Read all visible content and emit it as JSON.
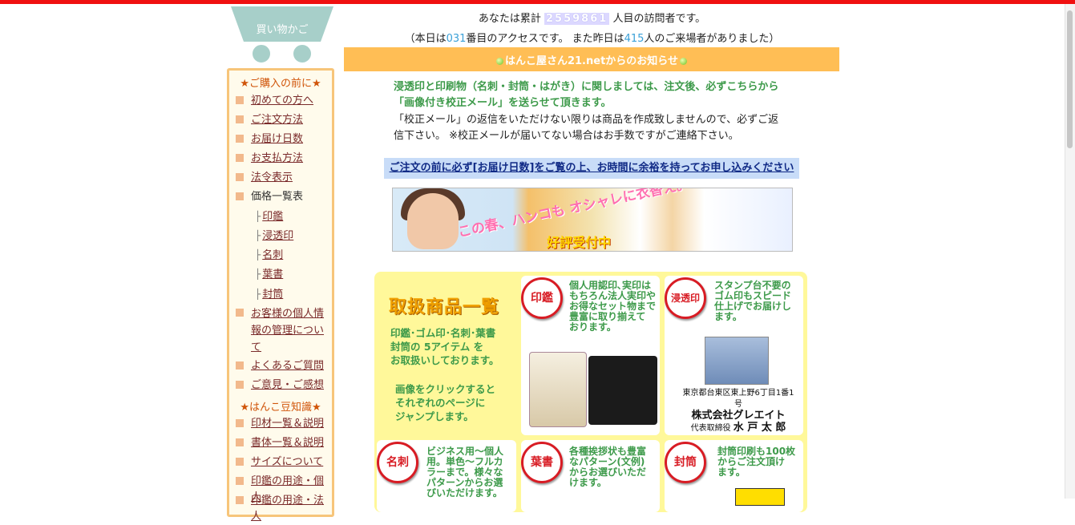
{
  "cart": {
    "label": "買い物かご"
  },
  "sidebar": {
    "heading1": "★ご購入の前に★",
    "items1": [
      "初めての方へ",
      "ご注文方法",
      "お届け日数",
      "お支払方法",
      "法令表示"
    ],
    "price_list": "価格一覧表",
    "price_sub": [
      "印鑑",
      "浸透印",
      "名刺",
      "葉書",
      "封筒"
    ],
    "tree_glyph": "├",
    "privacy": [
      "お客様の個人情",
      "報の管理につい",
      "て"
    ],
    "faq": "よくあるご質問",
    "feedback": "ご意見・ご感想",
    "heading2": "★はんこ豆知識★",
    "items2": [
      "印材一覧＆説明",
      "書体一覧＆説明",
      "サイズについて",
      "印鑑の用途・個人",
      "印鑑の用途・法人"
    ]
  },
  "header": {
    "visitor_prefix": "あなたは累計",
    "visitor_count": "2559861",
    "visitor_suffix": "人目の訪問者です。",
    "access_open": "（本日は",
    "today_count": "031",
    "access_mid": "番目のアクセスです。 また昨日は",
    "yesterday_count": "415",
    "access_close": "人のご来場者がありました）"
  },
  "notice": {
    "title": "はんこ屋さん21.netからのお知らせ",
    "line1": "浸透印と印刷物（名刺・封筒・はがき）に関しましては、注文後、必ずこちらから",
    "line2": "「画像付き校正メール」を送らせて頂きます。",
    "line3": "「校正メール」の返信をいただけない限りは商品を作成致しませんので、必ずご返",
    "line4": "信下さい。 ※校正メールが届いてない場合はお手数ですがご連絡下さい。",
    "warning": "ご注文の前に必ず[お届け日数]をご覧の上、お時間に余裕を持ってお申し込みください"
  },
  "banner": {
    "text1": "この春、ハンコも オシャレに衣替え。",
    "text2": "好評受付中"
  },
  "products": {
    "title": "取扱商品一覧",
    "desc1": [
      "印鑑･ゴム印･名刺･葉書",
      "封筒の 5アイテム を",
      "お取扱いしております。"
    ],
    "desc2": [
      "画像をクリックすると",
      "それぞれのページに",
      "ジャンプします。"
    ],
    "cells": [
      {
        "seal": "印鑑",
        "desc": [
          "個人用認印､実印は",
          "もちろん法人実印や",
          "お得なセット物まで",
          "豊富に取り揃えて",
          "おります。"
        ]
      },
      {
        "seal": "浸透印",
        "desc": [
          "スタンプ台不要の",
          "ゴム印もスピード",
          "仕上げでお届けし",
          "ます。"
        ],
        "stamp_address": "東京都台東区東上野6丁目1番1号",
        "stamp_company": "株式会社グレエイト",
        "stamp_title": "代表取締役",
        "stamp_name": "水 戸 太 郎"
      },
      {
        "seal": "名刺",
        "desc": [
          "ビジネス用〜個人",
          "用。単色〜フルカ",
          "ラーまで。様々な",
          "パターンからお選",
          "びいただけます。"
        ]
      },
      {
        "seal": "葉書",
        "desc": [
          "各種挨拶状も豊富",
          "なパターン(文例)",
          "からお選びいただ",
          "けます。"
        ]
      },
      {
        "seal": "封筒",
        "desc": [
          "封筒印刷も100枚",
          "からご注文頂け",
          "ます。"
        ]
      }
    ]
  },
  "colors": {
    "accent_orange": "#ffbe55",
    "seal_red": "#d81c24",
    "link": "#7a2a2a",
    "notice_green": "#3d9a4a"
  }
}
